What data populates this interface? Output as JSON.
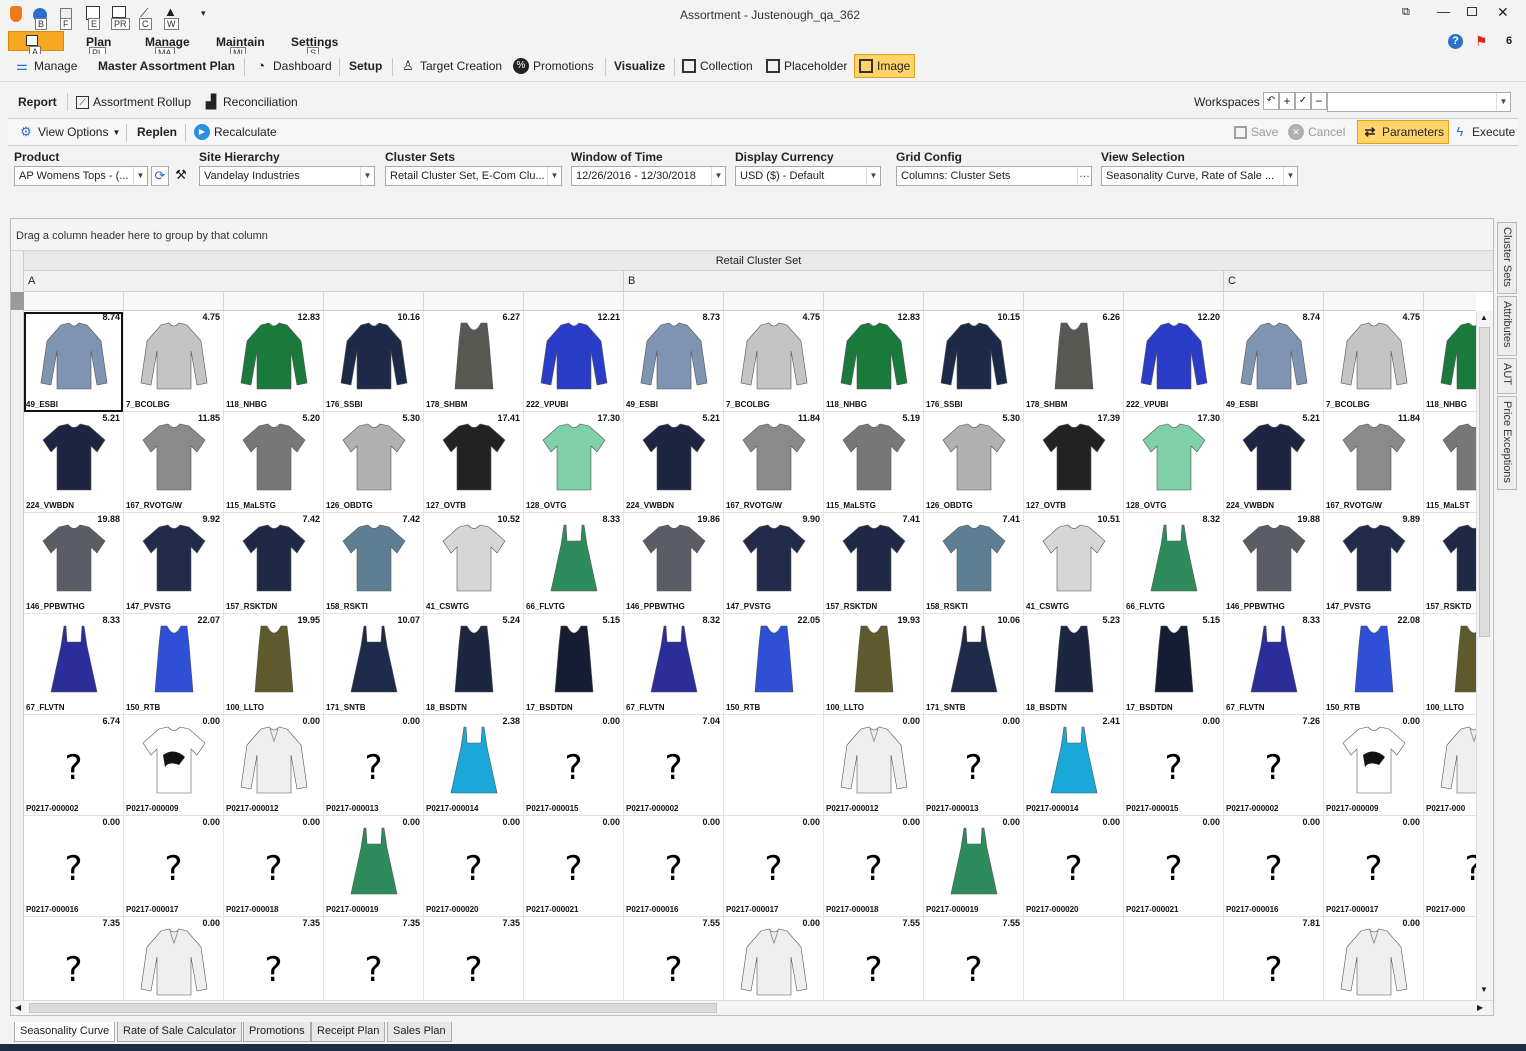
{
  "window": {
    "title": "Assortment - Justenough_qa_362",
    "help_count": "6"
  },
  "quick_access": {
    "keys": [
      "B",
      "F",
      "E",
      "PR",
      "C",
      "W",
      "A"
    ]
  },
  "ribbon_tabs": [
    {
      "label": "Plan",
      "key": "PL"
    },
    {
      "label": "Manage",
      "key": "MA"
    },
    {
      "label": "Maintain",
      "key": "MI"
    },
    {
      "label": "Settings",
      "key": "S"
    }
  ],
  "toolbar1": {
    "manage": "Manage",
    "master": "Master Assortment Plan",
    "dashboard": "Dashboard",
    "setup": "Setup",
    "target": "Target Creation",
    "promotions": "Promotions",
    "visualize": "Visualize",
    "collection": "Collection",
    "placeholder": "Placeholder",
    "image": "Image"
  },
  "toolbar2": {
    "report": "Report",
    "rollup": "Assortment Rollup",
    "reconciliation": "Reconciliation",
    "workspaces": "Workspaces",
    "workspace_value": ""
  },
  "toolbar3": {
    "view_options": "View Options",
    "replen": "Replen",
    "recalculate": "Recalculate",
    "save": "Save",
    "cancel": "Cancel",
    "parameters": "Parameters",
    "execute": "Execute"
  },
  "filters": {
    "product": {
      "label": "Product",
      "value": "AP Womens Tops - (..."
    },
    "site": {
      "label": "Site Hierarchy",
      "value": "Vandelay Industries"
    },
    "cluster_sets": {
      "label": "Cluster Sets",
      "value": "Retail Cluster Set, E-Com Clu..."
    },
    "window": {
      "label": "Window of Time",
      "value": "12/26/2016 - 12/30/2018"
    },
    "currency": {
      "label": "Display Currency",
      "value": "USD ($) - Default"
    },
    "grid_config": {
      "label": "Grid Config",
      "value": "Columns: Cluster Sets"
    },
    "view_selection": {
      "label": "View Selection",
      "value": "Seasonality Curve, Rate of Sale ..."
    }
  },
  "grid": {
    "group_hint": "Drag a column header here to group by that column",
    "band_title": "Retail Cluster Set",
    "groups": [
      "A",
      "B",
      "C"
    ],
    "rows": [
      [
        [
          "8.74",
          "49_ESBI",
          "longsleeve",
          "#7f93b3"
        ],
        [
          "4.75",
          "7_BCOLBG",
          "longsleeve",
          "#c4c4c4"
        ],
        [
          "12.83",
          "118_NHBG",
          "longsleeve",
          "#1a7a3c"
        ],
        [
          "10.16",
          "176_SSBI",
          "longsleeve",
          "#1c2a48"
        ],
        [
          "6.27",
          "178_SHBM",
          "tank",
          "#585852"
        ],
        [
          "12.21",
          "222_VPUBI",
          "longsleeve",
          "#2a3dc8"
        ],
        [
          "8.73",
          "49_ESBI",
          "longsleeve",
          "#7f93b3"
        ],
        [
          "4.75",
          "7_BCOLBG",
          "longsleeve",
          "#c4c4c4"
        ],
        [
          "12.83",
          "118_NHBG",
          "longsleeve",
          "#1a7a3c"
        ],
        [
          "10.15",
          "176_SSBI",
          "longsleeve",
          "#1c2a48"
        ],
        [
          "6.26",
          "178_SHBM",
          "tank",
          "#585852"
        ],
        [
          "12.20",
          "222_VPUBI",
          "longsleeve",
          "#2a3dc8"
        ],
        [
          "8.74",
          "49_ESBI",
          "longsleeve",
          "#7f93b3"
        ],
        [
          "4.75",
          "7_BCOLBG",
          "longsleeve",
          "#c4c4c4"
        ],
        [
          "",
          "118_NHBG",
          "longsleeve",
          "#1a7a3c"
        ]
      ],
      [
        [
          "5.21",
          "224_VWBDN",
          "tee",
          "#1e2540"
        ],
        [
          "11.85",
          "167_RVOTG/W",
          "tee",
          "#8a8a8a"
        ],
        [
          "5.20",
          "115_MaLSTG",
          "tee",
          "#777777"
        ],
        [
          "5.30",
          "126_OBDTG",
          "tee",
          "#b0b0b0"
        ],
        [
          "17.41",
          "127_OVTB",
          "tee",
          "#222222"
        ],
        [
          "17.30",
          "128_OVTG",
          "tee",
          "#7fcfa8"
        ],
        [
          "5.21",
          "224_VWBDN",
          "tee",
          "#1e2540"
        ],
        [
          "11.84",
          "167_RVOTG/W",
          "tee",
          "#8a8a8a"
        ],
        [
          "5.19",
          "115_MaLSTG",
          "tee",
          "#777777"
        ],
        [
          "5.30",
          "126_OBDTG",
          "tee",
          "#b0b0b0"
        ],
        [
          "17.39",
          "127_OVTB",
          "tee",
          "#222222"
        ],
        [
          "17.30",
          "128_OVTG",
          "tee",
          "#7fcfa8"
        ],
        [
          "5.21",
          "224_VWBDN",
          "tee",
          "#1e2540"
        ],
        [
          "11.84",
          "167_RVOTG/W",
          "tee",
          "#8a8a8a"
        ],
        [
          "",
          "115_MaLST",
          "tee",
          "#777777"
        ]
      ],
      [
        [
          "19.88",
          "146_PPBWTHG",
          "tee",
          "#5a5d66"
        ],
        [
          "9.92",
          "147_PVSTG",
          "tee",
          "#232b4a"
        ],
        [
          "7.42",
          "157_RSKTDN",
          "tee",
          "#1f2946"
        ],
        [
          "7.42",
          "158_RSKTI",
          "tee",
          "#5e7f93"
        ],
        [
          "10.52",
          "41_CSWTG",
          "tee",
          "#d6d6d6"
        ],
        [
          "8.33",
          "66_FLVTG",
          "cami",
          "#2e8c5c"
        ],
        [
          "19.86",
          "146_PPBWTHG",
          "tee",
          "#5a5d66"
        ],
        [
          "9.90",
          "147_PVSTG",
          "tee",
          "#232b4a"
        ],
        [
          "7.41",
          "157_RSKTDN",
          "tee",
          "#1f2946"
        ],
        [
          "7.41",
          "158_RSKTI",
          "tee",
          "#5e7f93"
        ],
        [
          "10.51",
          "41_CSWTG",
          "tee",
          "#d6d6d6"
        ],
        [
          "8.32",
          "66_FLVTG",
          "cami",
          "#2e8c5c"
        ],
        [
          "19.88",
          "146_PPBWTHG",
          "tee",
          "#5a5d66"
        ],
        [
          "9.89",
          "147_PVSTG",
          "tee",
          "#232b4a"
        ],
        [
          "",
          "157_RSKTD",
          "tee",
          "#1f2946"
        ]
      ],
      [
        [
          "8.33",
          "67_FLVTN",
          "cami",
          "#2b2d9a"
        ],
        [
          "22.07",
          "150_RTB",
          "tank",
          "#2f4fd6"
        ],
        [
          "19.95",
          "100_LLTO",
          "tank",
          "#5e5a2e"
        ],
        [
          "10.07",
          "171_SNTB",
          "cami",
          "#1e2a4a"
        ],
        [
          "5.24",
          "18_BSDTN",
          "tank",
          "#1d2640"
        ],
        [
          "5.15",
          "17_BSDTDN",
          "tank",
          "#161c33"
        ],
        [
          "8.32",
          "67_FLVTN",
          "cami",
          "#2b2d9a"
        ],
        [
          "22.05",
          "150_RTB",
          "tank",
          "#2f4fd6"
        ],
        [
          "19.93",
          "100_LLTO",
          "tank",
          "#5e5a2e"
        ],
        [
          "10.06",
          "171_SNTB",
          "cami",
          "#1e2a4a"
        ],
        [
          "5.23",
          "18_BSDTN",
          "tank",
          "#1d2640"
        ],
        [
          "5.15",
          "17_BSDTDN",
          "tank",
          "#161c33"
        ],
        [
          "8.33",
          "67_FLVTN",
          "cami",
          "#2b2d9a"
        ],
        [
          "22.08",
          "150_RTB",
          "tank",
          "#2f4fd6"
        ],
        [
          "",
          "100_LLTO",
          "tank",
          "#5e5a2e"
        ]
      ],
      [
        [
          "6.74",
          "P0217-000002",
          "q",
          ""
        ],
        [
          "0.00",
          "P0217-000009",
          "graphic",
          "#ffffff"
        ],
        [
          "0.00",
          "P0217-000012",
          "blouse",
          "#efefef"
        ],
        [
          "0.00",
          "P0217-000013",
          "q",
          ""
        ],
        [
          "2.38",
          "P0217-000014",
          "cami",
          "#1aa8d8"
        ],
        [
          "0.00",
          "P0217-000015",
          "q",
          ""
        ],
        [
          "7.04",
          "P0217-000002",
          "q",
          ""
        ],
        [
          "",
          "",
          "",
          ""
        ],
        [
          "0.00",
          "P0217-000012",
          "blouse",
          "#efefef"
        ],
        [
          "0.00",
          "P0217-000013",
          "q",
          ""
        ],
        [
          "2.41",
          "P0217-000014",
          "cami",
          "#1aa8d8"
        ],
        [
          "0.00",
          "P0217-000015",
          "q",
          ""
        ],
        [
          "7.26",
          "P0217-000002",
          "q",
          ""
        ],
        [
          "0.00",
          "P0217-000009",
          "graphic",
          "#ffffff"
        ],
        [
          "",
          "P0217-000",
          "blouse",
          "#efefef"
        ]
      ],
      [
        [
          "0.00",
          "P0217-000016",
          "q",
          ""
        ],
        [
          "0.00",
          "P0217-000017",
          "q",
          ""
        ],
        [
          "0.00",
          "P0217-000018",
          "q",
          ""
        ],
        [
          "0.00",
          "P0217-000019",
          "cami",
          "#2e8c5c"
        ],
        [
          "0.00",
          "P0217-000020",
          "q",
          ""
        ],
        [
          "0.00",
          "P0217-000021",
          "q",
          ""
        ],
        [
          "0.00",
          "P0217-000016",
          "q",
          ""
        ],
        [
          "0.00",
          "P0217-000017",
          "q",
          ""
        ],
        [
          "0.00",
          "P0217-000018",
          "q",
          ""
        ],
        [
          "0.00",
          "P0217-000019",
          "cami",
          "#2e8c5c"
        ],
        [
          "0.00",
          "P0217-000020",
          "q",
          ""
        ],
        [
          "0.00",
          "P0217-000021",
          "q",
          ""
        ],
        [
          "0.00",
          "P0217-000016",
          "q",
          ""
        ],
        [
          "0.00",
          "P0217-000017",
          "q",
          ""
        ],
        [
          "",
          "P0217-000",
          "q",
          ""
        ]
      ],
      [
        [
          "7.35",
          "",
          "q",
          ""
        ],
        [
          "0.00",
          "",
          "blouse",
          "#efefef"
        ],
        [
          "7.35",
          "",
          "q",
          ""
        ],
        [
          "7.35",
          "",
          "q",
          ""
        ],
        [
          "7.35",
          "",
          "q",
          ""
        ],
        [
          "",
          "",
          "",
          ""
        ],
        [
          "7.55",
          "",
          "q",
          ""
        ],
        [
          "0.00",
          "",
          "blouse",
          "#efefef"
        ],
        [
          "7.55",
          "",
          "q",
          ""
        ],
        [
          "7.55",
          "",
          "q",
          ""
        ],
        [
          "",
          "",
          "",
          ""
        ],
        [
          "",
          "",
          "",
          ""
        ],
        [
          "7.81",
          "",
          "q",
          ""
        ],
        [
          "0.00",
          "",
          "blouse",
          "#efefef"
        ],
        [
          "",
          "",
          "",
          ""
        ]
      ]
    ]
  },
  "side_tabs": [
    "Cluster Sets",
    "Attributes",
    "AUT",
    "Price Exceptions"
  ],
  "bottom_tabs": [
    "Seasonality Curve",
    "Rate of Sale Calculator",
    "Promotions",
    "Receipt Plan",
    "Sales Plan"
  ],
  "colors": {
    "accent": "#f5a623",
    "selected": "#ffd56b",
    "header_bg": "#e9e9e9"
  }
}
